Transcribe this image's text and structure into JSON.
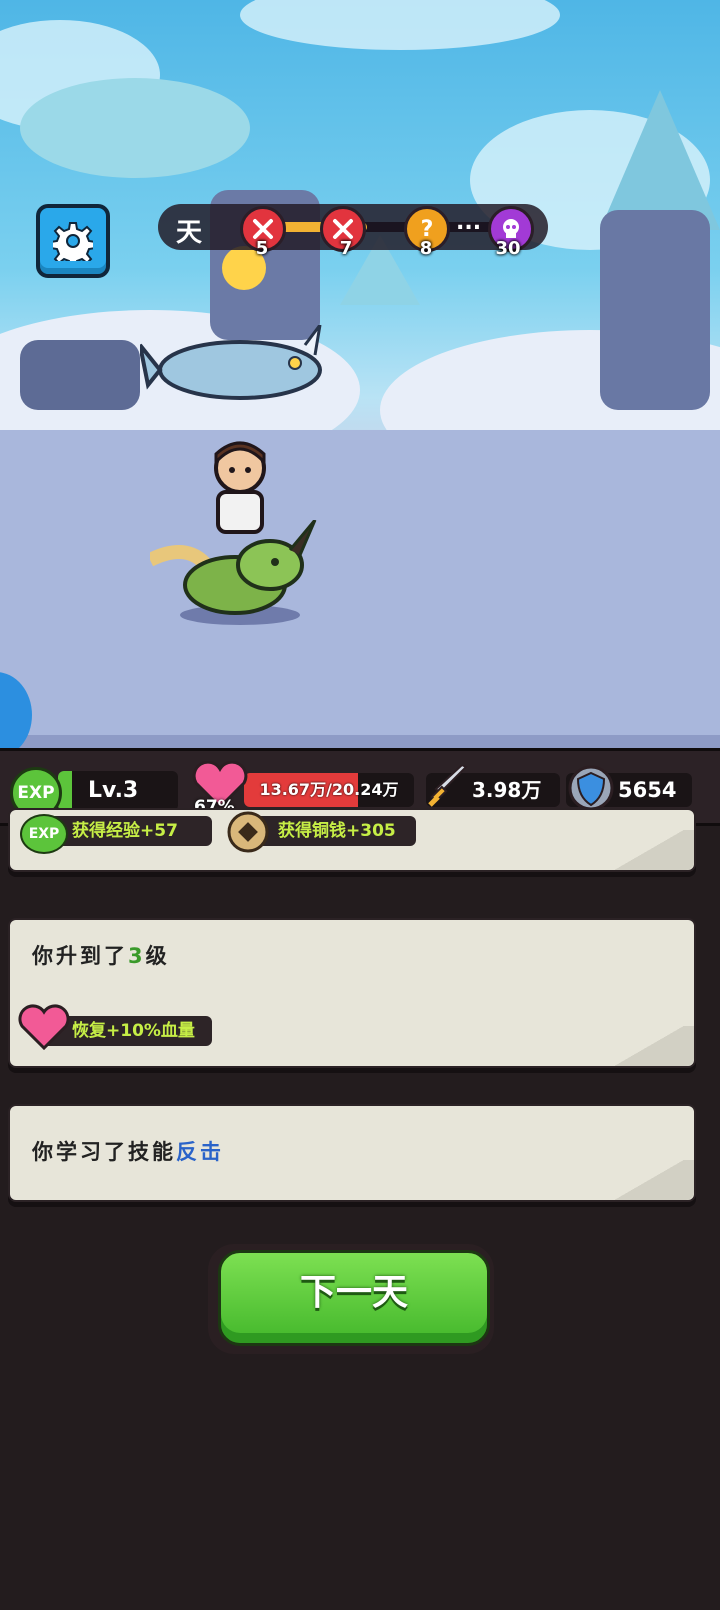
{
  "top_hud": {
    "day_label": "天",
    "markers": [
      {
        "number": "5",
        "type": "battle",
        "icon": "crossed-swords-icon",
        "color": "#e2343e"
      },
      {
        "number": "7",
        "type": "battle",
        "icon": "crossed-swords-icon",
        "color": "#e2343e"
      },
      {
        "number": "8",
        "type": "mystery",
        "icon": "question-icon",
        "glyph": "?",
        "color": "#f0a01e"
      },
      {
        "number": "30",
        "type": "boss",
        "icon": "skull-icon",
        "color": "#a23ad6"
      }
    ],
    "ellipsis": "...",
    "day_progress": 0.44
  },
  "status": {
    "exp_label": "EXP",
    "level": "Lv.3",
    "hp_text": "13.67万/20.24万",
    "hp_percent": "67%",
    "hp_fraction": 0.67,
    "attack": "3.98万",
    "defense": "5654"
  },
  "rewards": {
    "exp_label": "EXP",
    "exp_text": "获得经验+57",
    "coin_text": "获得铜钱+305"
  },
  "levelup": {
    "prefix": "你升到了",
    "level": "3",
    "suffix": "级",
    "heal_text": "恢复+10%血量"
  },
  "skill": {
    "prefix": "你学习了技能",
    "skill_name": "反击"
  },
  "next_button": "下一天",
  "colors": {
    "accent_green": "#5cc43b",
    "hp_red": "#e33b3b",
    "reward_text": "#c6ee46",
    "skill_blue": "#2a63c9",
    "level_green": "#3a9a2a"
  }
}
